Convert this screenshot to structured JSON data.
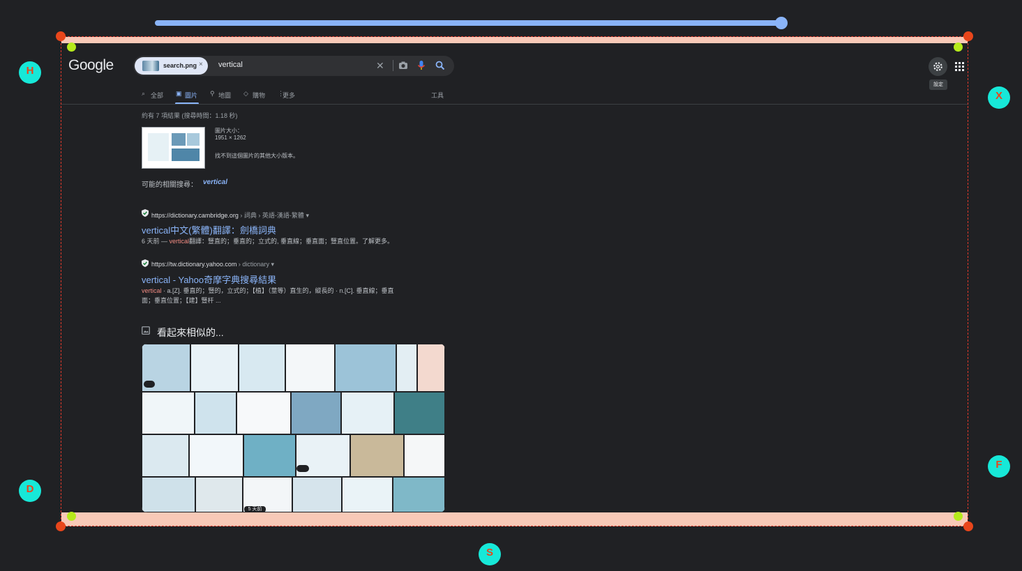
{
  "slider": {
    "value_percent": 100
  },
  "overlay_markers": {
    "top_left": "H",
    "right_upper": "X",
    "left_lower": "D",
    "right_lower": "F",
    "bottom_center": "S"
  },
  "google": {
    "logo": "Google",
    "search": {
      "chip_label": "search.png",
      "chip_remove": "×",
      "query": "vertical",
      "clear": "✕"
    },
    "icons": [
      "camera-icon",
      "mic-icon",
      "search-icon",
      "settings-gear-icon",
      "apps-grid-icon"
    ],
    "settings_tooltip": "設定",
    "tabs": [
      {
        "label": "全部",
        "icon": "search-icon"
      },
      {
        "label": "圖片",
        "icon": "image-icon",
        "active": true
      },
      {
        "label": "地圖",
        "icon": "map-pin-icon"
      },
      {
        "label": "購物",
        "icon": "tag-icon"
      },
      {
        "label": "更多",
        "icon": "more-vert-icon"
      }
    ],
    "tools_label": "工具",
    "result_stats": "約有 7 項結果 (搜尋時間：1.18 秒)",
    "image_info": {
      "size_label": "圖片大小：",
      "size_value": "1951 × 1262",
      "no_other_sizes": "找不到這個圖片的其他大小版本。"
    },
    "related_search_label": "可能的相關搜尋：",
    "related_search_term": "vertical",
    "results": [
      {
        "url": "https://dictionary.cambridge.org",
        "breadcrumb": "› 詞典 › 英語-漢語-繁體",
        "title": "vertical中文(繁體)翻譯：劍橋詞典",
        "snippet_prefix": "6 天前 — ",
        "snippet_em": "vertical",
        "snippet_rest": "翻譯：豎直的；垂直的；立式的, 垂直線；垂直面；豎直位置。了解更多。"
      },
      {
        "url": "https://tw.dictionary.yahoo.com",
        "breadcrumb": "› dictionary",
        "title": "vertical - Yahoo奇摩字典搜尋結果",
        "snippet_em": "vertical",
        "snippet_rest": " · a.[Z]. 垂直的；豎的，立式的；【植】（莖等）直生的，縱長的 · n.[C]. 垂直線；垂直",
        "snippet_line2": "面；垂直位置；【建】豎杆 ..."
      }
    ],
    "similar_heading": "看起來相似的...",
    "similar_badge_time": "5 天前"
  },
  "colors": {
    "accent": "#8ab4f8",
    "marker": "#17e8d8",
    "marker_text": "#e8461b",
    "corner": "#e8461b",
    "handle": "#b6ea1c",
    "band": "#f8c9b7"
  }
}
